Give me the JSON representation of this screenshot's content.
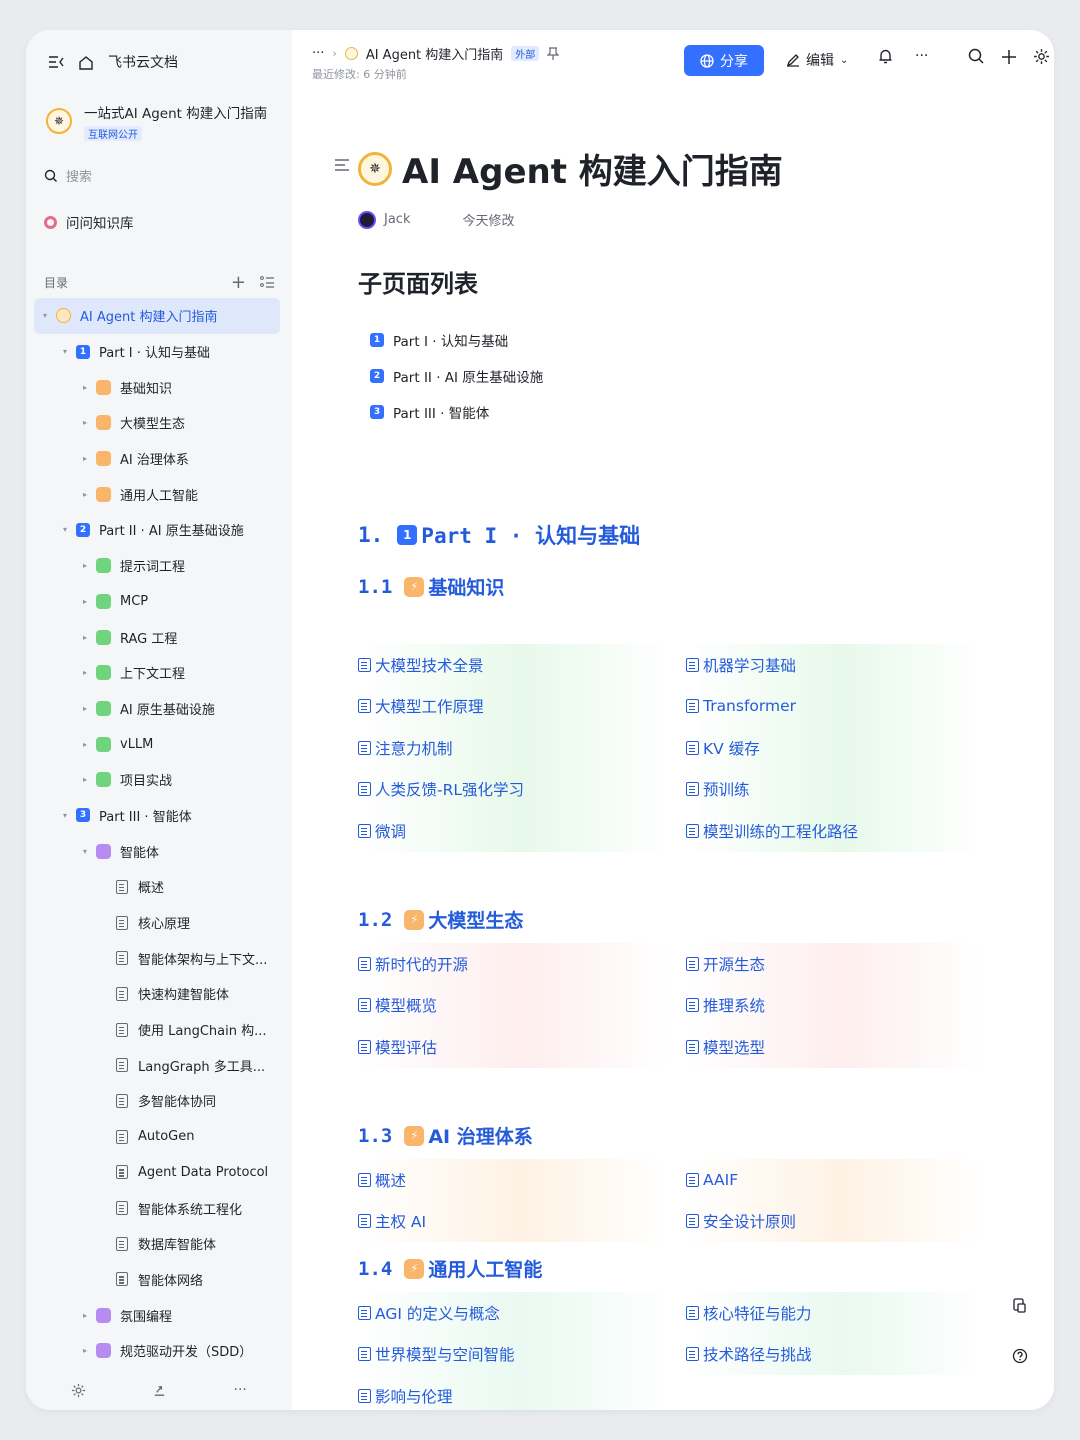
{
  "app": {
    "name": "飞书云文档"
  },
  "sidebar": {
    "doc_title": "一站式AI Agent 构建入门指南",
    "doc_tag": "互联网公开",
    "search_placeholder": "搜索",
    "knowledge_base": "问问知识库",
    "toc_label": "目录",
    "items": [
      {
        "label": "AI Agent 构建入门指南",
        "level": 0,
        "kind": "ring",
        "caret": "▾"
      },
      {
        "label": "Part I · 认知与基础",
        "level": 1,
        "kind": "num",
        "num": "1",
        "caret": "▾"
      },
      {
        "label": "基础知识",
        "level": 2,
        "kind": "orange",
        "caret": "▸"
      },
      {
        "label": "大模型生态",
        "level": 2,
        "kind": "orange",
        "caret": "▸"
      },
      {
        "label": "AI 治理体系",
        "level": 2,
        "kind": "orange",
        "caret": "▸"
      },
      {
        "label": "通用人工智能",
        "level": 2,
        "kind": "orange",
        "caret": "▸"
      },
      {
        "label": "Part II · AI 原生基础设施",
        "level": 1,
        "kind": "num",
        "num": "2",
        "caret": "▾"
      },
      {
        "label": "提示词工程",
        "level": 2,
        "kind": "green",
        "caret": "▸"
      },
      {
        "label": "MCP",
        "level": 2,
        "kind": "green",
        "caret": "▸"
      },
      {
        "label": "RAG 工程",
        "level": 2,
        "kind": "green",
        "caret": "▸"
      },
      {
        "label": "上下文工程",
        "level": 2,
        "kind": "green",
        "caret": "▸"
      },
      {
        "label": "AI 原生基础设施",
        "level": 2,
        "kind": "green",
        "caret": "▸"
      },
      {
        "label": "vLLM",
        "level": 2,
        "kind": "green",
        "caret": "▸"
      },
      {
        "label": "项目实战",
        "level": 2,
        "kind": "green",
        "caret": "▸"
      },
      {
        "label": "Part III · 智能体",
        "level": 1,
        "kind": "num",
        "num": "3",
        "caret": "▾"
      },
      {
        "label": "智能体",
        "level": 2,
        "kind": "purple",
        "caret": "▾"
      },
      {
        "label": "概述",
        "level": 3,
        "kind": "doc",
        "caret": ""
      },
      {
        "label": "核心原理",
        "level": 3,
        "kind": "doc",
        "caret": ""
      },
      {
        "label": "智能体架构与上下文...",
        "level": 3,
        "kind": "doc",
        "caret": ""
      },
      {
        "label": "快速构建智能体",
        "level": 3,
        "kind": "doc",
        "caret": ""
      },
      {
        "label": "使用 LangChain 构...",
        "level": 3,
        "kind": "doc",
        "caret": ""
      },
      {
        "label": "LangGraph 多工具...",
        "level": 3,
        "kind": "doc",
        "caret": ""
      },
      {
        "label": "多智能体协同",
        "level": 3,
        "kind": "doc",
        "caret": ""
      },
      {
        "label": "AutoGen",
        "level": 3,
        "kind": "doc",
        "caret": ""
      },
      {
        "label": "Agent Data Protocol",
        "level": 3,
        "kind": "doc",
        "caret": ""
      },
      {
        "label": "智能体系统工程化",
        "level": 3,
        "kind": "doc",
        "caret": ""
      },
      {
        "label": "数据库智能体",
        "level": 3,
        "kind": "doc",
        "caret": ""
      },
      {
        "label": "智能体网络",
        "level": 3,
        "kind": "doc",
        "caret": ""
      },
      {
        "label": "氛围编程",
        "level": 2,
        "kind": "purple",
        "caret": "▸"
      },
      {
        "label": "规范驱动开发（SDD）",
        "level": 2,
        "kind": "purple",
        "caret": "▸"
      }
    ]
  },
  "topbar": {
    "breadcrumb_more": "···",
    "breadcrumb_title": "AI Agent 构建入门指南",
    "external_tag": "外部",
    "last_modified": "最近修改: 6 分钟前",
    "share_label": "分享",
    "edit_label": "编辑"
  },
  "doc": {
    "title": "AI Agent 构建入门指南",
    "author": "Jack",
    "modified": "今天修改",
    "subpages_heading": "子页面列表",
    "subpages": [
      {
        "num": "1",
        "label": "Part I · 认知与基础"
      },
      {
        "num": "2",
        "label": "Part II · AI 原生基础设施"
      },
      {
        "num": "3",
        "label": "Part III · 智能体"
      }
    ],
    "section1": {
      "num": "1.",
      "badge": "1",
      "title": "Part I · 认知与基础"
    },
    "s11": {
      "num": "1.1",
      "title": "基础知识",
      "links": [
        "大模型技术全景",
        "机器学习基础",
        "大模型工作原理",
        "Transformer",
        "注意力机制",
        "KV 缓存",
        "人类反馈-RL强化学习",
        "预训练",
        "微调",
        "模型训练的工程化路径"
      ]
    },
    "s12": {
      "num": "1.2",
      "title": "大模型生态",
      "links": [
        "新时代的开源",
        "开源生态",
        "模型概览",
        "推理系统",
        "模型评估",
        "模型选型"
      ]
    },
    "s13": {
      "num": "1.3",
      "title": "AI 治理体系",
      "links": [
        "概述",
        "AAIF",
        "主权 AI",
        "安全设计原则"
      ]
    },
    "s14": {
      "num": "1.4",
      "title": "通用人工智能",
      "links": [
        "AGI 的定义与概念",
        "核心特征与能力",
        "世界模型与空间智能",
        "技术路径与挑战",
        "影响与伦理"
      ]
    }
  }
}
